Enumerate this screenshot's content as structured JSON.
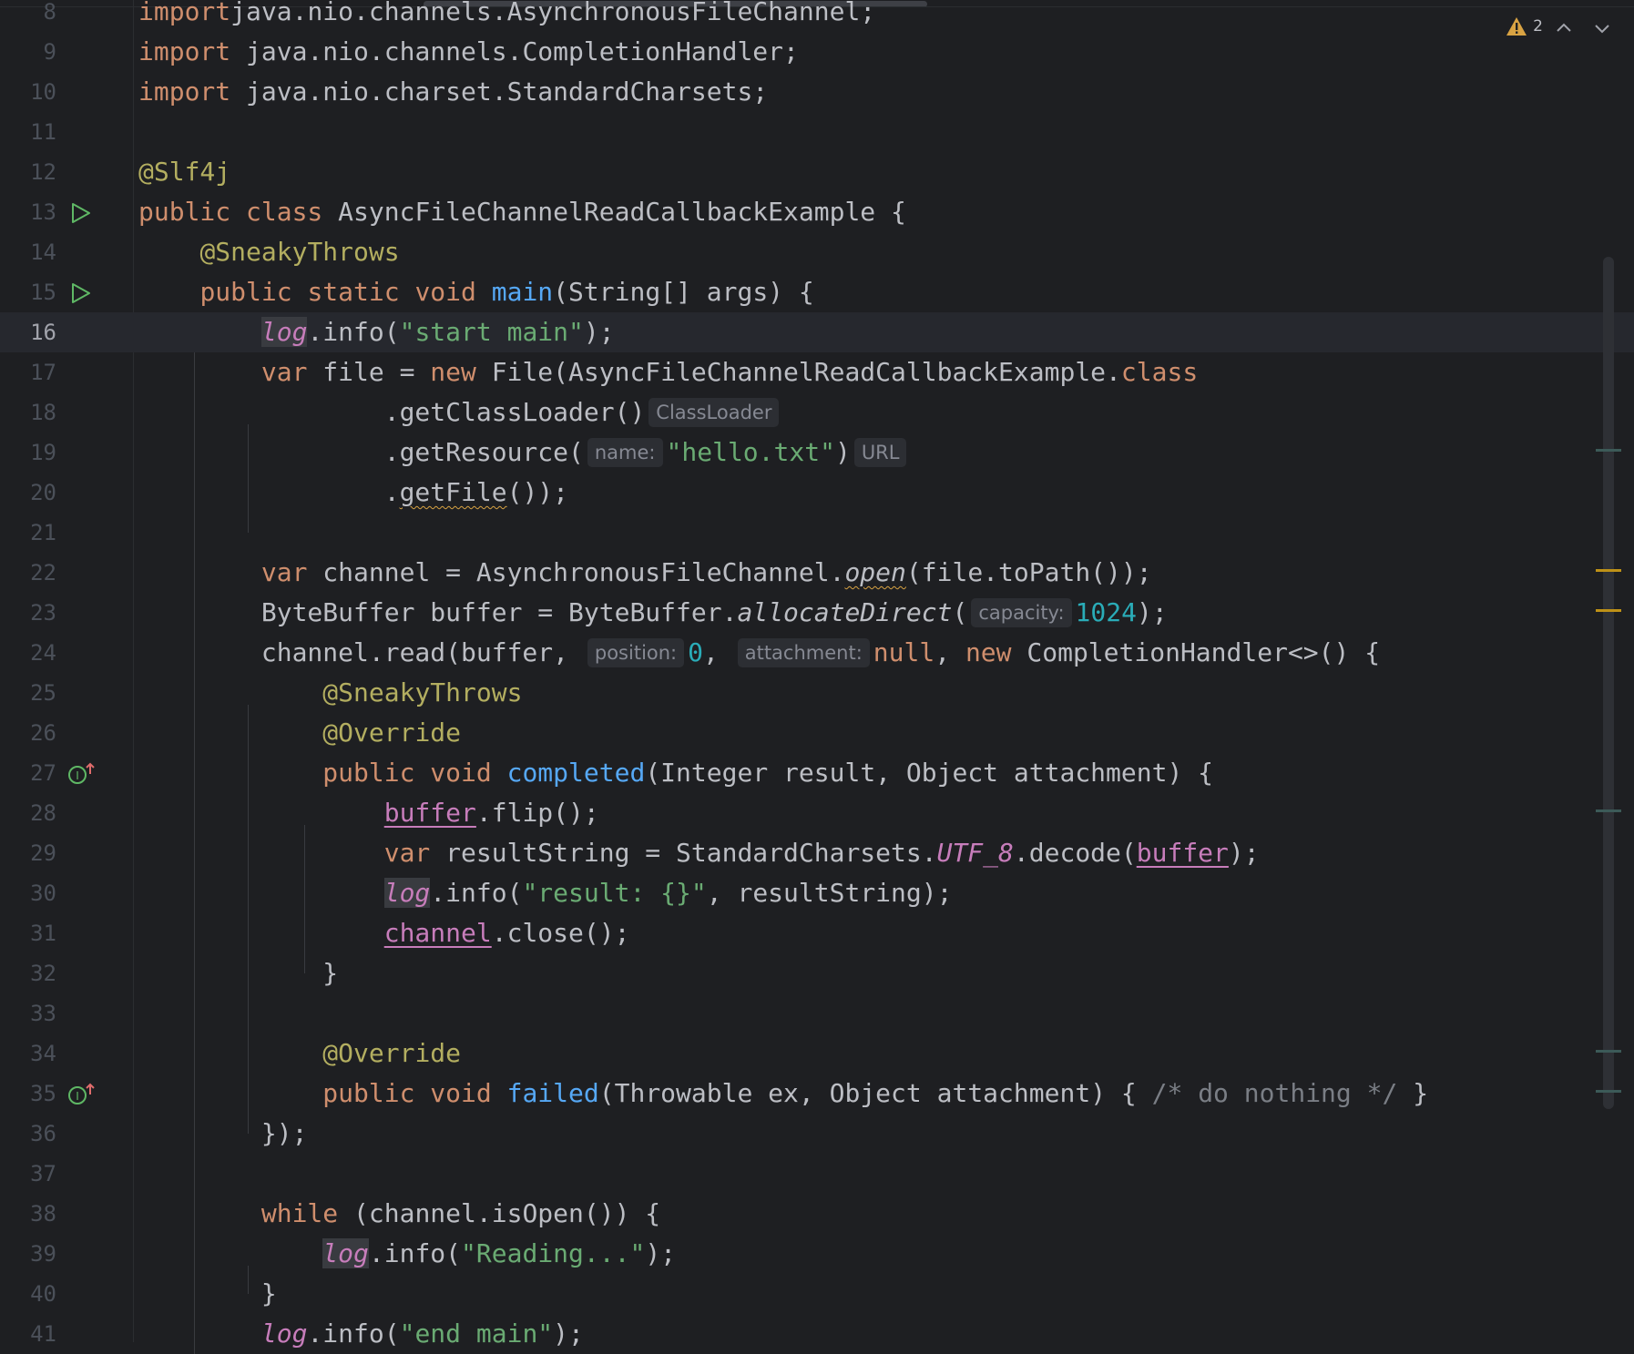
{
  "editor": {
    "inspection": {
      "warning_count": "2"
    },
    "lines": [
      {
        "num": "8",
        "tokens": [
          [
            "kw",
            "import"
          ],
          [
            "",
            "java.nio.channels.AsynchronousFileChannel;"
          ]
        ]
      },
      {
        "num": "9",
        "tokens": [
          [
            "kw",
            "import"
          ],
          [
            "",
            " java.nio.channels.CompletionHandler;"
          ]
        ]
      },
      {
        "num": "10",
        "tokens": [
          [
            "kw",
            "import"
          ],
          [
            "",
            " java.nio.charset.StandardCharsets;"
          ]
        ]
      },
      {
        "num": "11",
        "tokens": []
      },
      {
        "num": "12",
        "tokens": [
          [
            "ann",
            "@Slf4j"
          ]
        ]
      },
      {
        "num": "13",
        "gutter": "run",
        "tokens": [
          [
            "kw",
            "public class"
          ],
          [
            "",
            " AsyncFileChannelReadCallbackExample {"
          ]
        ]
      },
      {
        "num": "14",
        "tokens": [
          [
            "",
            "    "
          ],
          [
            "ann",
            "@SneakyThrows"
          ]
        ]
      },
      {
        "num": "15",
        "gutter": "run",
        "tokens": [
          [
            "",
            "    "
          ],
          [
            "kw",
            "public static void"
          ],
          [
            "",
            " "
          ],
          [
            "fn",
            "main"
          ],
          [
            "",
            "(String[] args) {"
          ]
        ]
      },
      {
        "num": "16",
        "current": true,
        "tokens": [
          [
            "",
            "        "
          ],
          [
            "fld it hlbg",
            "log"
          ],
          [
            "",
            ".info("
          ],
          [
            "str",
            "\"start main\""
          ],
          [
            "",
            ");"
          ]
        ]
      },
      {
        "num": "17",
        "tokens": [
          [
            "",
            "        "
          ],
          [
            "kw",
            "var"
          ],
          [
            "",
            " file = "
          ],
          [
            "kw",
            "new"
          ],
          [
            "",
            " File(AsyncFileChannelReadCallbackExample."
          ],
          [
            "kw",
            "class"
          ]
        ]
      },
      {
        "num": "18",
        "tokens": [
          [
            "",
            "                .getClassLoader()"
          ],
          [
            "hint",
            "ClassLoader"
          ]
        ]
      },
      {
        "num": "19",
        "tokens": [
          [
            "",
            "                .getResource("
          ],
          [
            "hint",
            "name:"
          ],
          [
            "str",
            "\"hello.txt\""
          ],
          [
            "",
            ")"
          ],
          [
            "hint",
            "URL"
          ]
        ]
      },
      {
        "num": "20",
        "tokens": [
          [
            "",
            "                ."
          ],
          [
            "warn",
            "getFile"
          ],
          [
            "",
            "());"
          ]
        ]
      },
      {
        "num": "21",
        "tokens": []
      },
      {
        "num": "22",
        "tokens": [
          [
            "",
            "        "
          ],
          [
            "kw",
            "var"
          ],
          [
            "",
            " channel = AsynchronousFileChannel."
          ],
          [
            "it warn",
            "open"
          ],
          [
            "",
            "(file.toPath());"
          ]
        ]
      },
      {
        "num": "23",
        "tokens": [
          [
            "",
            "        ByteBuffer buffer = ByteBuffer."
          ],
          [
            "it",
            "allocateDirect"
          ],
          [
            "",
            "("
          ],
          [
            "hint",
            "capacity:"
          ],
          [
            "num",
            "1024"
          ],
          [
            "",
            ");"
          ]
        ]
      },
      {
        "num": "24",
        "tokens": [
          [
            "",
            "        channel.read(buffer, "
          ],
          [
            "hint",
            "position:"
          ],
          [
            "num",
            "0"
          ],
          [
            "",
            ", "
          ],
          [
            "hint",
            "attachment:"
          ],
          [
            "kw",
            "null"
          ],
          [
            "",
            ", "
          ],
          [
            "kw",
            "new"
          ],
          [
            "",
            " CompletionHandler<>() {"
          ]
        ]
      },
      {
        "num": "25",
        "tokens": [
          [
            "",
            "            "
          ],
          [
            "ann",
            "@SneakyThrows"
          ]
        ]
      },
      {
        "num": "26",
        "tokens": [
          [
            "",
            "            "
          ],
          [
            "ann",
            "@Override"
          ]
        ]
      },
      {
        "num": "27",
        "gutter": "impl",
        "tokens": [
          [
            "",
            "            "
          ],
          [
            "kw",
            "public void"
          ],
          [
            "",
            " "
          ],
          [
            "fn",
            "completed"
          ],
          [
            "",
            "(Integer result, Object attachment) {"
          ]
        ]
      },
      {
        "num": "28",
        "tokens": [
          [
            "",
            "                "
          ],
          [
            "fld ul",
            "buffer"
          ],
          [
            "",
            ".flip();"
          ]
        ]
      },
      {
        "num": "29",
        "tokens": [
          [
            "",
            "                "
          ],
          [
            "kw",
            "var"
          ],
          [
            "",
            " resultString = StandardCharsets."
          ],
          [
            "fld it",
            "UTF_8"
          ],
          [
            "",
            ".decode("
          ],
          [
            "fld ul",
            "buffer"
          ],
          [
            "",
            ");"
          ]
        ]
      },
      {
        "num": "30",
        "tokens": [
          [
            "",
            "                "
          ],
          [
            "fld it hlbg",
            "log"
          ],
          [
            "",
            ".info("
          ],
          [
            "str",
            "\"result: {}\""
          ],
          [
            "",
            ", resultString);"
          ]
        ]
      },
      {
        "num": "31",
        "tokens": [
          [
            "",
            "                "
          ],
          [
            "fld ul",
            "channel"
          ],
          [
            "",
            ".close();"
          ]
        ]
      },
      {
        "num": "32",
        "tokens": [
          [
            "",
            "            }"
          ]
        ]
      },
      {
        "num": "33",
        "tokens": []
      },
      {
        "num": "34",
        "tokens": [
          [
            "",
            "            "
          ],
          [
            "ann",
            "@Override"
          ]
        ]
      },
      {
        "num": "35",
        "gutter": "impl",
        "tokens": [
          [
            "",
            "            "
          ],
          [
            "kw",
            "public void"
          ],
          [
            "",
            " "
          ],
          [
            "fn",
            "failed"
          ],
          [
            "",
            "(Throwable ex, Object attachment) { "
          ],
          [
            "cm",
            "/* do nothing */"
          ],
          [
            "",
            " }"
          ]
        ]
      },
      {
        "num": "36",
        "tokens": [
          [
            "",
            "        });"
          ]
        ]
      },
      {
        "num": "37",
        "tokens": []
      },
      {
        "num": "38",
        "tokens": [
          [
            "",
            "        "
          ],
          [
            "kw",
            "while"
          ],
          [
            "",
            " (channel.isOpen()) {"
          ]
        ]
      },
      {
        "num": "39",
        "tokens": [
          [
            "",
            "            "
          ],
          [
            "fld it hlbg",
            "log"
          ],
          [
            "",
            ".info("
          ],
          [
            "str",
            "\"Reading...\""
          ],
          [
            "",
            ");"
          ]
        ]
      },
      {
        "num": "40",
        "tokens": [
          [
            "",
            "        }"
          ]
        ]
      },
      {
        "num": "41",
        "tokens": [
          [
            "",
            "        "
          ],
          [
            "fld it",
            "log"
          ],
          [
            "",
            ".info("
          ],
          [
            "str",
            "\"end main\""
          ],
          [
            "",
            ");"
          ]
        ]
      }
    ],
    "gutter_icons": {
      "run": "run-triangle-icon",
      "impl": "implements-method-icon"
    },
    "scroll_marks": [
      {
        "line": 19,
        "color": "#3c5a58"
      },
      {
        "line": 22,
        "color": "#be9117"
      },
      {
        "line": 23,
        "color": "#be9117"
      },
      {
        "line": 28,
        "color": "#3c5a58"
      },
      {
        "line": 34,
        "color": "#3c5a58"
      },
      {
        "line": 35,
        "color": "#3c5a58"
      }
    ],
    "colors": {
      "background": "#1e1f22",
      "keyword": "#cf8e6d",
      "annotation": "#b3ae60",
      "string": "#6aab73",
      "number": "#2aacb8",
      "method": "#56a8f5",
      "field": "#c77dbb",
      "warning": "#d9a343"
    }
  }
}
